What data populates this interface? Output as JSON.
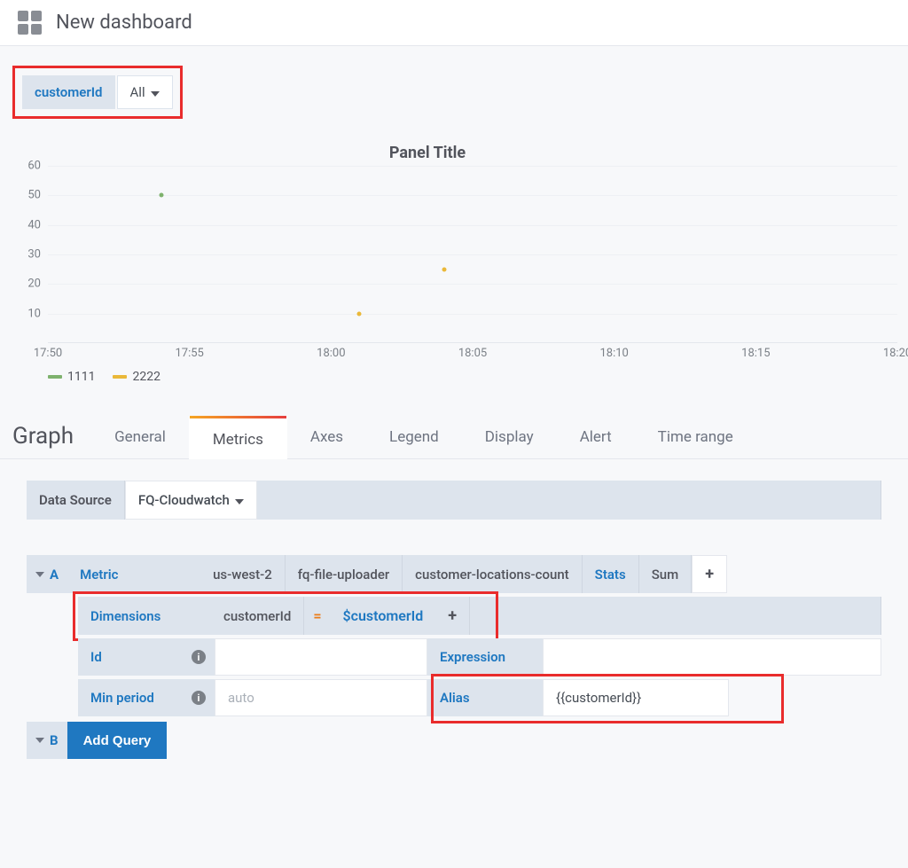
{
  "header": {
    "title": "New dashboard"
  },
  "variable": {
    "label": "customerId",
    "value": "All"
  },
  "panel": {
    "title": "Panel Title"
  },
  "chart_data": {
    "type": "scatter",
    "title": "Panel Title",
    "ylim": [
      0,
      60
    ],
    "y_ticks": [
      10,
      20,
      30,
      40,
      50,
      60
    ],
    "x_labels": [
      "17:50",
      "17:55",
      "18:00",
      "18:05",
      "18:10",
      "18:15",
      "18:20"
    ],
    "x_range_minutes": [
      0,
      30
    ],
    "series": [
      {
        "name": "1111",
        "color": "#7eb26d",
        "points": [
          {
            "x_min": 4,
            "y": 50
          }
        ]
      },
      {
        "name": "2222",
        "color": "#eab839",
        "points": [
          {
            "x_min": 11,
            "y": 10
          },
          {
            "x_min": 14,
            "y": 25
          }
        ]
      }
    ]
  },
  "legend": [
    {
      "label": "1111",
      "color": "#7eb26d"
    },
    {
      "label": "2222",
      "color": "#eab839"
    }
  ],
  "editor": {
    "section_label": "Graph",
    "tabs": [
      "General",
      "Metrics",
      "Axes",
      "Legend",
      "Display",
      "Alert",
      "Time range"
    ],
    "active_tab": "Metrics",
    "datasource_label": "Data Source",
    "datasource_value": "FQ-Cloudwatch",
    "queries": {
      "A": {
        "metric_label": "Metric",
        "region": "us-west-2",
        "namespace": "fq-file-uploader",
        "metric_name": "customer-locations-count",
        "stats_label": "Stats",
        "stats_value": "Sum",
        "dimensions_label": "Dimensions",
        "dim_key": "customerId",
        "dim_val": "$customerId",
        "id_label": "Id",
        "id_value": "",
        "expression_label": "Expression",
        "expression_value": "",
        "min_period_label": "Min period",
        "min_period_placeholder": "auto",
        "alias_label": "Alias",
        "alias_value": "{{customerId}}"
      },
      "B": {
        "add_query_label": "Add Query"
      }
    }
  }
}
